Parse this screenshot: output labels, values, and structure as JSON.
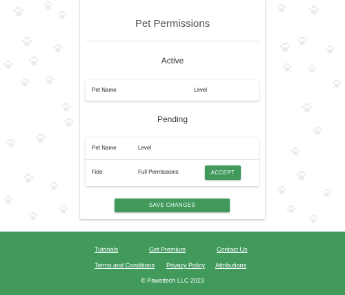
{
  "card": {
    "title": "Pet Permissions"
  },
  "active": {
    "title": "Active",
    "columns": [
      "Pet Name",
      "Level"
    ]
  },
  "pending": {
    "title": "Pending",
    "columns": [
      "Pet Name",
      "Level"
    ],
    "rows": [
      {
        "name": "Fido",
        "level": "Full Permissions",
        "action": "ACCEPT"
      }
    ]
  },
  "save_label": "SAVE CHANGES",
  "footer": {
    "links_row1": [
      "Tutorials",
      "Get Premium",
      "Contact Us"
    ],
    "links_row2": [
      "Terms and Conditions",
      "Privacy Policy",
      "Attributions"
    ],
    "copyright": "© Pawsitech LLC 2023"
  },
  "colors": {
    "accent": "#419a5c",
    "background": "#ffffff",
    "paw": "#ececec"
  },
  "icons": {
    "background_pattern": "paw-print-icon"
  }
}
